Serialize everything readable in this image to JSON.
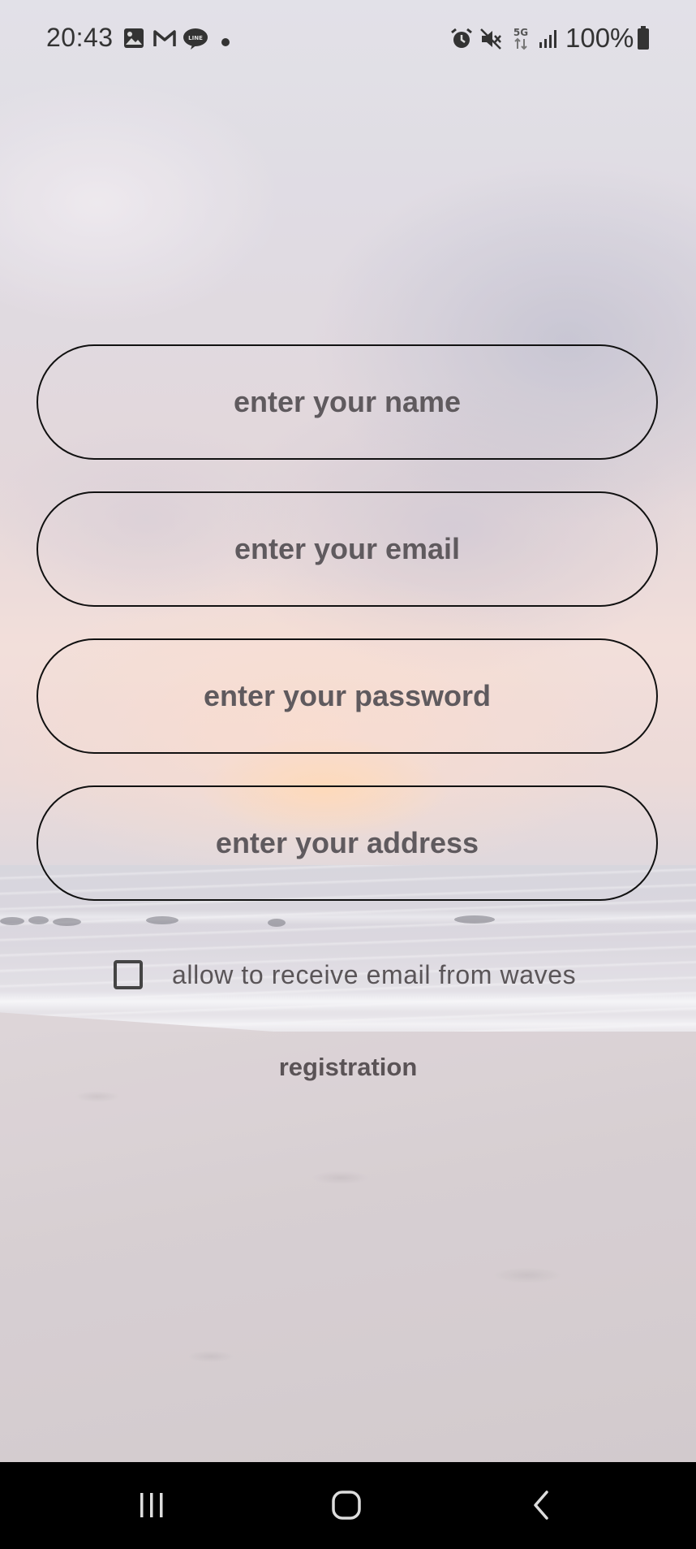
{
  "status_bar": {
    "time": "20:43",
    "battery_percent": "100%",
    "left_icons": [
      "image-icon",
      "gmail-icon",
      "line-icon",
      "dot-icon"
    ],
    "right_icons": [
      "alarm-icon",
      "mute-icon",
      "5g-icon",
      "signal-icon",
      "battery-icon"
    ],
    "network_label": "5G"
  },
  "form": {
    "name_placeholder": "enter your name",
    "email_placeholder": "enter your email",
    "password_placeholder": "enter your password",
    "address_placeholder": "enter your address",
    "checkbox_label": "allow to receive email from waves",
    "checkbox_checked": false,
    "register_label": "registration"
  },
  "nav_bar": {
    "icons": [
      "recents-icon",
      "home-icon",
      "back-icon"
    ]
  },
  "colors": {
    "border": "#111111",
    "placeholder": "#5f5a5e",
    "nav_background": "#000000"
  }
}
